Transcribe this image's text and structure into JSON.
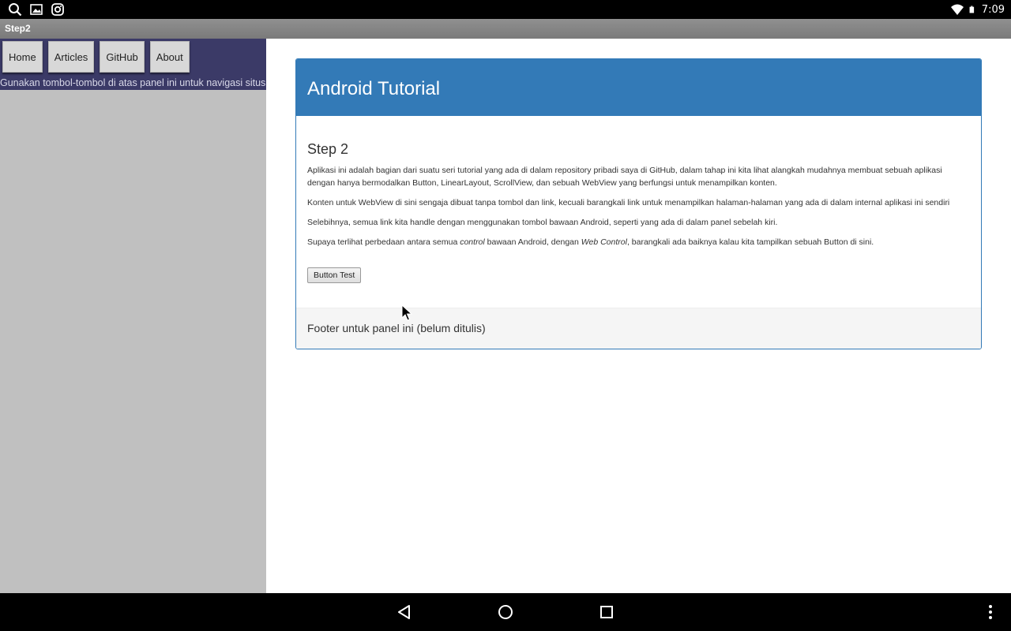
{
  "status_bar": {
    "time": "7:09",
    "left_icons": [
      "search-icon",
      "image-icon",
      "instagram-icon"
    ],
    "right_icons": [
      "wifi-icon",
      "battery-icon"
    ]
  },
  "window": {
    "title": "Step2"
  },
  "nav": {
    "buttons": [
      "Home",
      "Articles",
      "GitHub",
      "About"
    ],
    "hint": "Gunakan tombol-tombol di atas panel ini untuk navigasi situs."
  },
  "panel": {
    "heading": "Android Tutorial",
    "step_title": "Step 2",
    "paragraph1": "Aplikasi ini adalah bagian dari suatu seri tutorial yang ada di dalam repository pribadi saya di GitHub, dalam tahap ini kita lihat alangkah mudahnya membuat sebuah aplikasi dengan hanya bermodalkan Button, LinearLayout, ScrollView, dan sebuah WebView yang berfungsi untuk menampilkan konten.",
    "paragraph2": "Konten untuk WebView di sini sengaja dibuat tanpa tombol dan link, kecuali barangkali link untuk menampilkan halaman-halaman yang ada di dalam internal aplikasi ini sendiri",
    "paragraph3": "Selebihnya, semua link kita handle dengan menggunakan tombol bawaan Android, seperti yang ada di dalam panel sebelah kiri.",
    "paragraph4": {
      "part1": "Supaya terlihat perbedaan antara semua ",
      "em1": "control",
      "part2": " bawaan Android, dengan ",
      "em2": "Web Control",
      "part3": ", barangkali ada baiknya kalau kita tampilkan sebuah Button di sini."
    },
    "button_label": "Button Test",
    "footer": "Footer untuk panel ini (belum ditulis)"
  },
  "system_nav": {
    "icons": [
      "back-icon",
      "home-icon",
      "recents-icon",
      "overflow-menu-icon"
    ]
  },
  "colors": {
    "panel_primary": "#337ab7",
    "nav_background": "#3b3a67",
    "left_panel_background": "#c0c0c0"
  }
}
